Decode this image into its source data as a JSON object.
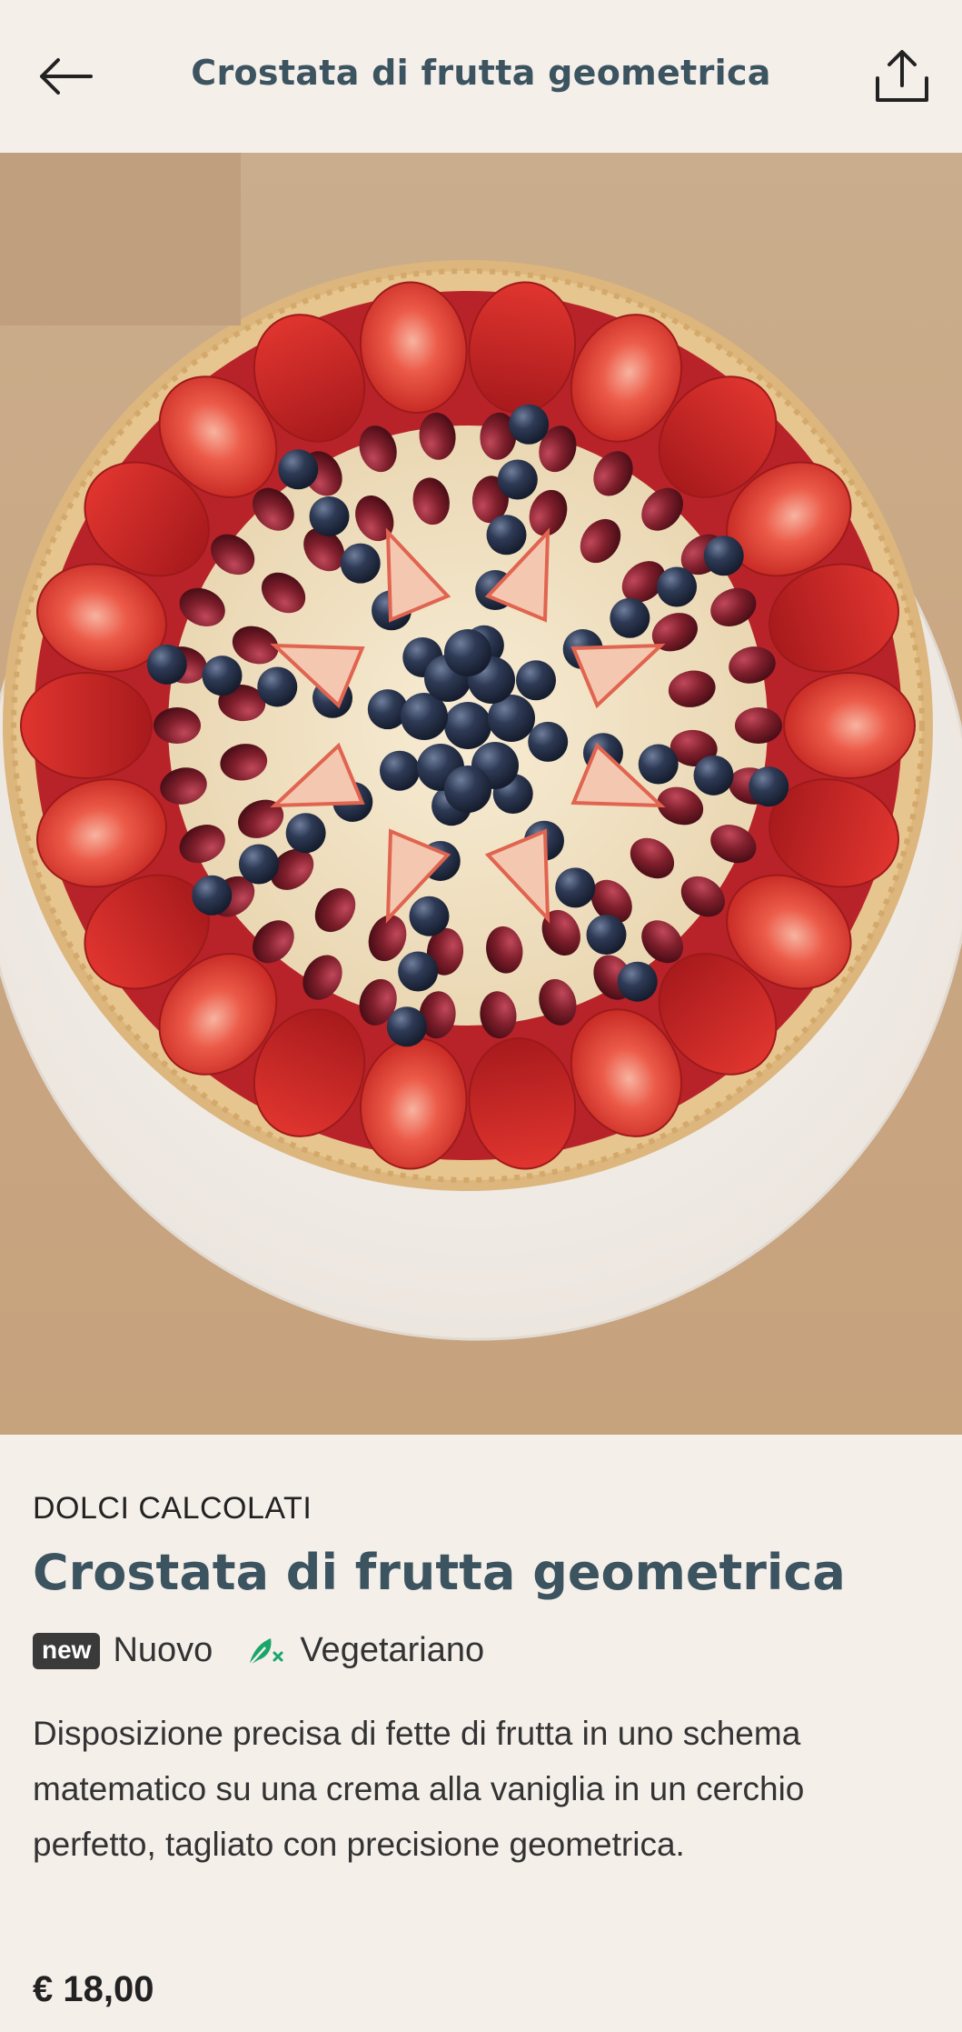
{
  "header": {
    "title": "Crostata di frutta geometrica",
    "back_icon": "arrow-left-icon",
    "share_icon": "share-upload-icon"
  },
  "hero": {
    "image_subject": "round fruit tart with strawberries, blueberries and grapes arranged in a geometric pattern on a white plate"
  },
  "product": {
    "category": "DOLCI CALCOLATI",
    "title": "Crostata di frutta geometrica",
    "badge_new": "new",
    "tag_new": "Nuovo",
    "tag_vegetarian": "Vegetariano",
    "description": "Disposizione precisa di fette di frutta in uno schema matematico su una crema alla vaniglia in un cerchio perfetto, tagliato con precisione geometrica.",
    "price": "€ 18,00"
  },
  "colors": {
    "background": "#f5efea",
    "title_color": "#3c5360",
    "vegetarian_green": "#1aa56a"
  }
}
